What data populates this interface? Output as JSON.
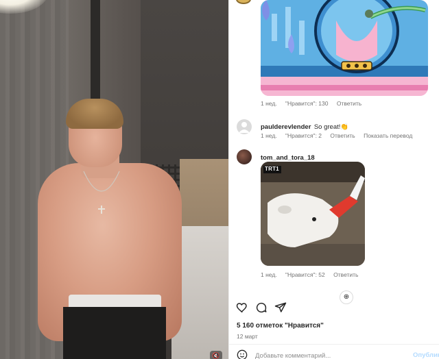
{
  "media": {
    "mute_icon": "speaker-muted-icon",
    "mute_glyph": "🔇"
  },
  "comments": [
    {
      "kind": "sticker",
      "meta": {
        "time": "1 нед.",
        "likes": "\"Нравится\": 130",
        "reply": "Ответить"
      }
    },
    {
      "kind": "text",
      "username": "paulderevlender",
      "text": "So great!👏",
      "meta": {
        "time": "1 нед.",
        "likes": "\"Нравится\": 2",
        "reply": "Ответить",
        "translate": "Показать перевод"
      }
    },
    {
      "kind": "sticker",
      "username": "tom_and_tora_18",
      "sticker_badge": "TRT1",
      "meta": {
        "time": "1 нед.",
        "likes": "\"Нравится\": 52",
        "reply": "Ответить"
      }
    }
  ],
  "actions": {
    "like_icon": "heart-icon",
    "comment_icon": "comment-bubble-icon",
    "share_icon": "paper-plane-icon"
  },
  "likes_count": "5 160 отметок \"Нравится\"",
  "date": "12 март",
  "composer": {
    "placeholder": "Добавьте комментарий...",
    "post_label": "Опублик",
    "emoji_icon": "smiley-icon"
  },
  "colors": {
    "meta_text": "#737373",
    "post_button": "#b3dbff"
  }
}
